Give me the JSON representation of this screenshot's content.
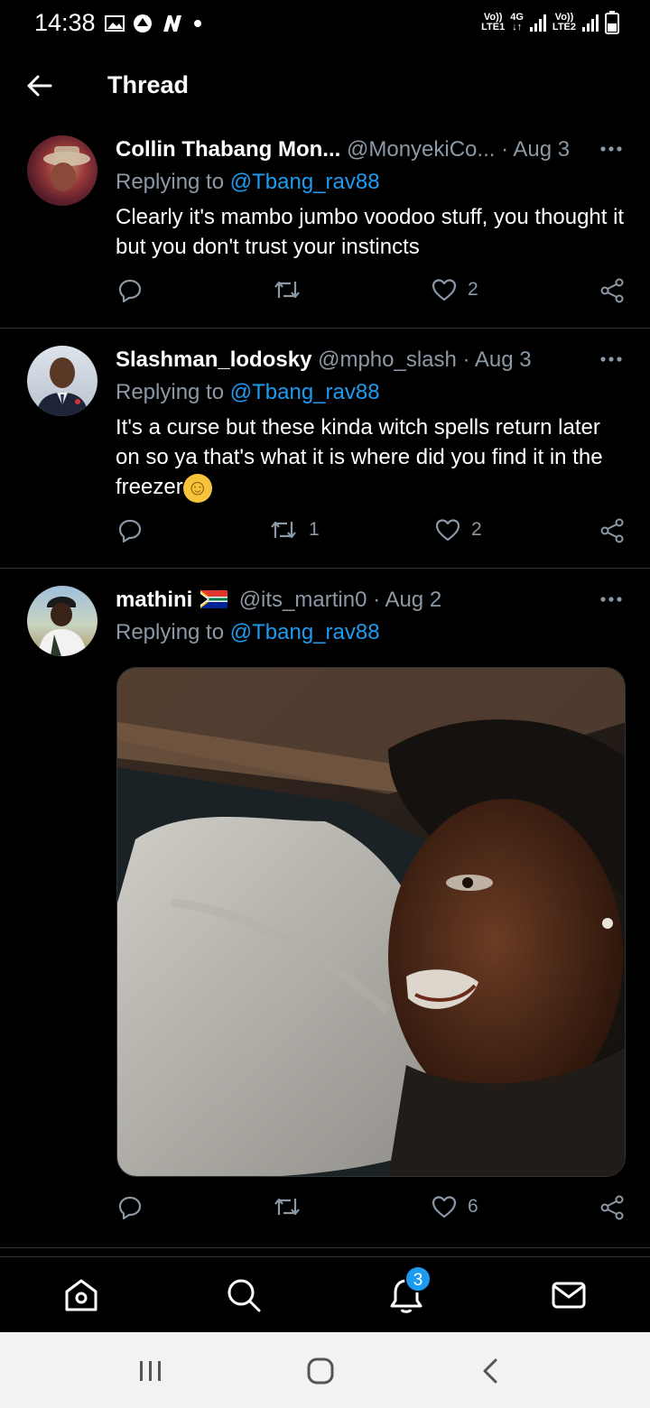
{
  "status_bar": {
    "time": "14:38",
    "left_icons": [
      "image-icon",
      "notification-icon",
      "n-icon",
      "dot-icon"
    ],
    "sim1_top": "Vo))",
    "sim1_bottom": "LTE1",
    "network": "4G",
    "sim2_top": "Vo))",
    "sim2_bottom": "LTE2"
  },
  "header": {
    "title": "Thread"
  },
  "tweets": [
    {
      "name": "Collin Thabang Mon...",
      "handle": "@MonyekiCo...",
      "date": "· Aug 3",
      "replying_prefix": "Replying to ",
      "replying_to": "@Tbang_rav88",
      "text": "Clearly it's mambo jumbo voodoo stuff, you thought it but you don't trust your instincts",
      "retweets": "",
      "likes": "2"
    },
    {
      "name": "Slashman_lodosky",
      "handle": "@mpho_slash",
      "date": "· Aug 3",
      "replying_prefix": "Replying to ",
      "replying_to": "@Tbang_rav88",
      "text": "It's a curse but these kinda witch spells return later on so ya that's what it is where did you find it in the freezer",
      "emoji": "☺",
      "retweets": "1",
      "likes": "2"
    },
    {
      "name": "mathini",
      "flag": "south-africa-flag-icon",
      "handle": "@its_martin0",
      "date": "· Aug 2",
      "replying_prefix": "Replying to ",
      "replying_to": "@Tbang_rav88",
      "retweets": "",
      "likes": "6"
    }
  ],
  "bottom_nav": {
    "items": [
      "home-icon",
      "search-icon",
      "notifications-icon",
      "messages-icon"
    ],
    "notification_badge": "3"
  },
  "colors": {
    "background": "#000000",
    "link": "#1d9bf0",
    "muted": "#8b98a5",
    "divider": "#2f3336"
  }
}
